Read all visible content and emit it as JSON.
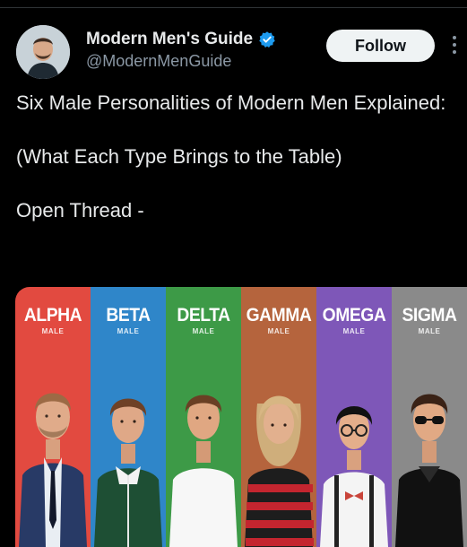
{
  "account": {
    "name": "Modern Men's Guide",
    "handle": "@ModernMenGuide",
    "verified_icon": "verified-badge-icon"
  },
  "follow_label": "Follow",
  "tweet": {
    "lines": [
      "Six Male Personalities of Modern Men Explained:",
      "(What Each Type Brings to the Table)",
      "Open Thread -"
    ]
  },
  "media": {
    "panels": [
      {
        "title": "ALPHA",
        "sub": "MALE",
        "color": "#e24a40"
      },
      {
        "title": "BETA",
        "sub": "MALE",
        "color": "#2f86c9"
      },
      {
        "title": "DELTA",
        "sub": "MALE",
        "color": "#3d9a47"
      },
      {
        "title": "GAMMA",
        "sub": "MALE",
        "color": "#b5643d"
      },
      {
        "title": "OMEGA",
        "sub": "MALE",
        "color": "#7e57b8"
      },
      {
        "title": "SIGMA",
        "sub": "MALE",
        "color": "#8a8a8a"
      }
    ]
  }
}
